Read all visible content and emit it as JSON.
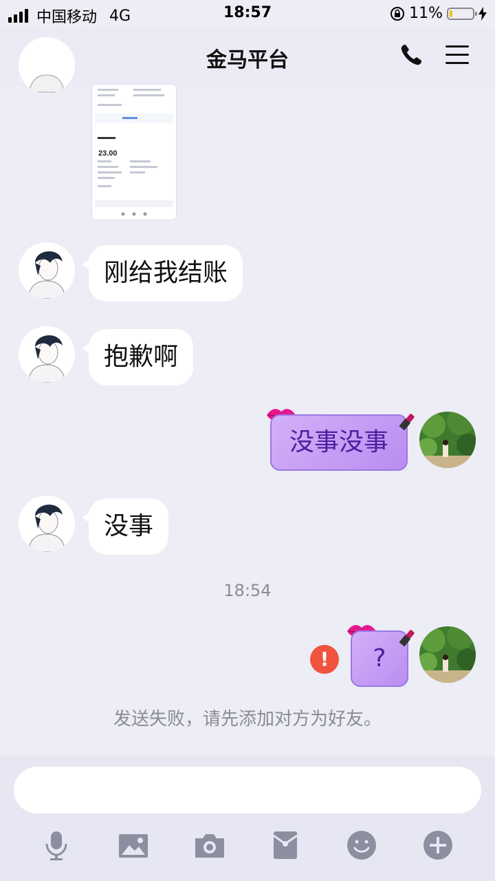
{
  "status_bar": {
    "carrier": "中国移动",
    "network": "4G",
    "time": "18:57",
    "battery_percent": "11%",
    "battery_level": 0.11
  },
  "header": {
    "title": "金马平台",
    "icons": {
      "back": "chevron-left-icon",
      "call": "phone-icon",
      "menu": "hamburger-menu-icon"
    }
  },
  "messages": [
    {
      "side": "left",
      "text": "刚给我结账"
    },
    {
      "side": "left",
      "text": "抱歉啊"
    },
    {
      "side": "right",
      "text": "没事没事"
    },
    {
      "side": "left",
      "text": "没事"
    },
    {
      "side": "right",
      "text": "?"
    }
  ],
  "time_separator": "18:54",
  "failed_notice": "发送失败，请先添加对方为好友。",
  "shared_image": {
    "amount": "23.00"
  },
  "toolbar": {
    "icons": [
      "microphone-icon",
      "image-icon",
      "camera-icon",
      "red-packet-icon",
      "emoji-icon",
      "plus-icon"
    ]
  },
  "colors": {
    "background": "#ECEDF5",
    "outgoing_bubble": "#C9A6F5",
    "outgoing_text": "#4C1FA0",
    "error": "#F0533E",
    "meta_text": "#8A8B94"
  }
}
